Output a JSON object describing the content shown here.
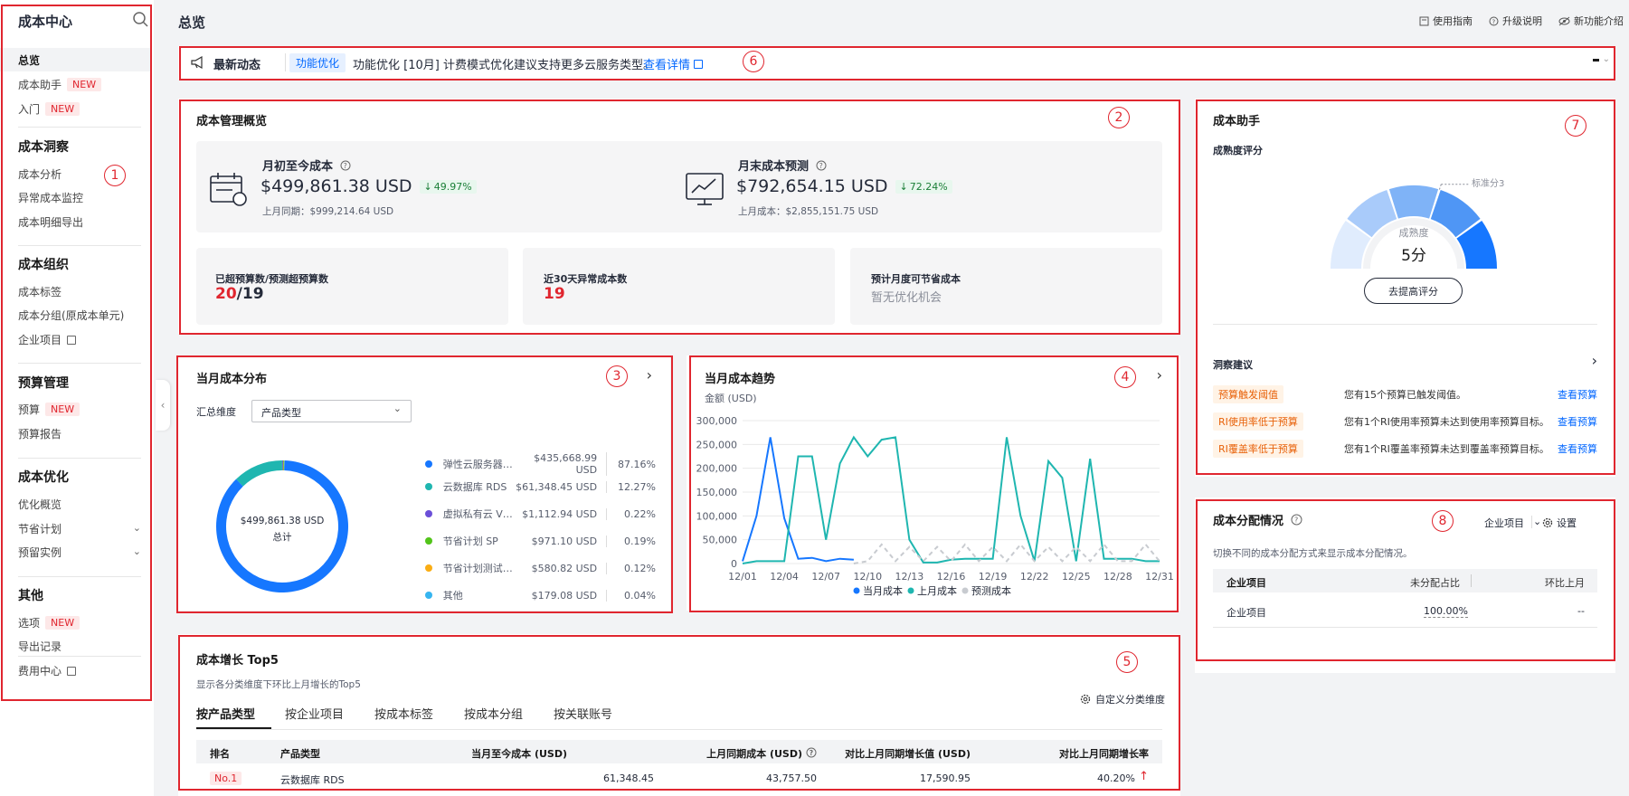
{
  "sidebar": {
    "title": "成本中心",
    "top_items": [
      {
        "label": "总览",
        "active": true
      },
      {
        "label": "成本助手",
        "badge": "NEW"
      },
      {
        "label": "入门",
        "badge": "NEW"
      }
    ],
    "groups": [
      {
        "title": "成本洞察",
        "items": [
          {
            "label": "成本分析"
          },
          {
            "label": "异常成本监控"
          },
          {
            "label": "成本明细导出"
          }
        ]
      },
      {
        "title": "成本组织",
        "items": [
          {
            "label": "成本标签"
          },
          {
            "label": "成本分组(原成本单元)"
          },
          {
            "label": "企业项目"
          }
        ]
      },
      {
        "title": "预算管理",
        "items": [
          {
            "label": "预算",
            "badge": "NEW"
          },
          {
            "label": "预算报告"
          }
        ]
      },
      {
        "title": "成本优化",
        "items": [
          {
            "label": "优化概览"
          },
          {
            "label": "节省计划"
          },
          {
            "label": "预留实例"
          }
        ]
      },
      {
        "title": "其他",
        "items": [
          {
            "label": "选项",
            "badge": "NEW"
          },
          {
            "label": "导出记录"
          },
          {
            "label": "费用中心"
          }
        ]
      }
    ]
  },
  "header": {
    "title": "总览",
    "links": [
      "使用指南",
      "升级说明",
      "新功能介绍"
    ]
  },
  "news": {
    "title": "最新动态",
    "tag": "功能优化",
    "text": "功能优化 [10月] 计费模式优化建议支持更多云服务类型。",
    "link": "查看详情"
  },
  "overview": {
    "title": "成本管理概览",
    "mtd": {
      "label": "月初至今成本",
      "value": "$499,861.38 USD",
      "change": "49.97%",
      "prev": "上月同期：$999,214.64 USD"
    },
    "forecast": {
      "label": "月末成本预测",
      "value": "$792,654.15 USD",
      "change": "72.24%",
      "prev": "上月成本：$2,855,151.75 USD"
    },
    "budget": {
      "label": "已超预算数/预测超预算数",
      "over": "20",
      "sep": "/",
      "forecast": "19"
    },
    "anomaly": {
      "label": "近30天异常成本数",
      "value": "19"
    },
    "saving": {
      "label": "预计月度可节省成本",
      "value": "暂无优化机会"
    }
  },
  "distribution": {
    "title": "当月成本分布",
    "dim_label": "汇总维度",
    "dim_value": "产品类型",
    "center_value": "$499,861.38 USD",
    "center_label": "总计",
    "colors": [
      "#1677ff",
      "#1fb6b0",
      "#6b4fd8",
      "#52c41a",
      "#faad14",
      "#36b5f0"
    ],
    "items": [
      {
        "name": "弹性云服务器 ECS",
        "value": "$435,668.99 USD",
        "pct": "87.16%",
        "share": 87.16
      },
      {
        "name": "云数据库 RDS",
        "value": "$61,348.45 USD",
        "pct": "12.27%",
        "share": 12.27
      },
      {
        "name": "虚拟私有云 VPC",
        "value": "$1,112.94 USD",
        "pct": "0.22%",
        "share": 0.22
      },
      {
        "name": "节省计划 SP",
        "value": "$971.10 USD",
        "pct": "0.19%",
        "share": 0.19
      },
      {
        "name": "节省计划测试云服务",
        "value": "$580.82 USD",
        "pct": "0.12%",
        "share": 0.12
      },
      {
        "name": "其他",
        "value": "$179.08 USD",
        "pct": "0.04%",
        "share": 0.04
      }
    ]
  },
  "trend": {
    "title": "当月成本趋势",
    "chart_data": {
      "type": "line",
      "ylabel": "金额 (USD)",
      "ylim": [
        0,
        300000
      ],
      "yticks": [
        "0",
        "50,000",
        "100,000",
        "150,000",
        "200,000",
        "250,000",
        "300,000"
      ],
      "yvals": [
        0,
        50000,
        100000,
        150000,
        200000,
        250000,
        300000
      ],
      "xticks": [
        "12/01",
        "12/04",
        "12/07",
        "12/10",
        "12/13",
        "12/16",
        "12/19",
        "12/22",
        "12/25",
        "12/28",
        "12/31"
      ],
      "series": [
        {
          "name": "当月成本",
          "color": "#1677ff",
          "dash": false,
          "values": [
            5000,
            100000,
            265000,
            95000,
            10000,
            12000,
            5000,
            10000,
            8000
          ]
        },
        {
          "name": "上月成本",
          "color": "#1fb6b0",
          "dash": false,
          "values": [
            0,
            5000,
            5000,
            5000,
            225000,
            225000,
            50000,
            210000,
            265000,
            225000,
            260000,
            265000,
            50000,
            2000,
            2000,
            8000,
            10000,
            10000,
            10000,
            265000,
            100000,
            5000,
            215000,
            180000,
            5000,
            220000,
            10000,
            10000,
            10000,
            5000,
            5000
          ]
        },
        {
          "name": "预测成本",
          "color": "#c8cbd0",
          "dash": true,
          "values": [
            null,
            null,
            null,
            null,
            null,
            null,
            null,
            null,
            0,
            5000,
            40000,
            5000,
            35000,
            5000,
            35000,
            5000,
            40000,
            5000,
            35000,
            5000,
            40000,
            5000,
            35000,
            5000,
            35000,
            5000,
            40000,
            5000,
            5000,
            40000,
            5000
          ]
        }
      ]
    }
  },
  "growth": {
    "title": "成本增长 Top5",
    "subtitle": "显示各分类维度下环比上月增长的Top5",
    "custom_label": "自定义分类维度",
    "tabs": [
      "按产品类型",
      "按企业项目",
      "按成本标签",
      "按成本分组",
      "按关联账号"
    ],
    "headers": [
      "排名",
      "产品类型",
      "当月至今成本 (USD)",
      "上月同期成本 (USD)",
      "对比上月同期增长值 (USD)",
      "对比上月同期增长率"
    ],
    "rows": [
      {
        "rank": "No.1",
        "name": "云数据库 RDS",
        "mtd": "61,348.45",
        "prev": "43,757.50",
        "growth": "17,590.95",
        "rate": "40.20%"
      }
    ]
  },
  "assistant": {
    "title": "成本助手",
    "maturity_label": "成熟度评分",
    "gauge_ref": "标准分3",
    "gauge_label": "成熟度",
    "gauge_value": "5分",
    "score": 5,
    "max_score": 5,
    "improve_button": "去提高评分",
    "insight_title": "洞察建议",
    "insights": [
      {
        "tag": "预算触发阈值",
        "text": "您有15个预算已触发阈值。",
        "link": "查看预算"
      },
      {
        "tag": "RI使用率低于预算",
        "text": "您有1个RI使用率预算未达到使用率预算目标。",
        "link": "查看预算"
      },
      {
        "tag": "RI覆盖率低于预算",
        "text": "您有1个RI覆盖率预算未达到覆盖率预算目标。",
        "link": "查看预算"
      }
    ]
  },
  "allocation": {
    "title": "成本分配情况",
    "select_value": "企业项目",
    "settings": "设置",
    "desc": "切换不同的成本分配方式来显示成本分配情况。",
    "headers": [
      "企业项目",
      "未分配占比",
      "环比上月"
    ],
    "rows": [
      {
        "name": "企业项目",
        "pct": "100.00%",
        "mom": "--"
      }
    ]
  },
  "markers": [
    "1",
    "2",
    "3",
    "4",
    "5",
    "6",
    "7",
    "8"
  ]
}
